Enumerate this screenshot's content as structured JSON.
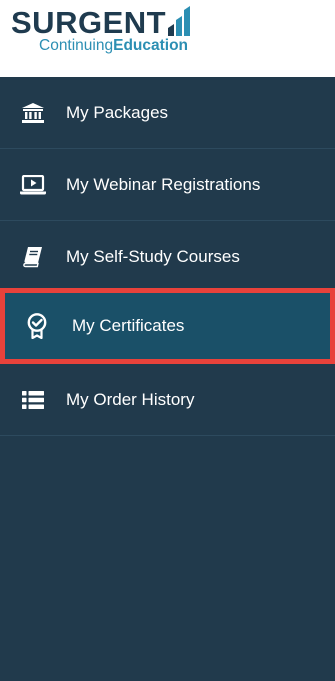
{
  "logo": {
    "word": "SURGENT",
    "sub_regular": "Continuing",
    "sub_bold": "Education"
  },
  "colors": {
    "sidebar_bg": "#213a4c",
    "active_bg": "#1a5068",
    "highlight": "#e8423b",
    "logo_dark": "#1f3b4f",
    "logo_accent": "#2c8fb3"
  },
  "nav": {
    "items": [
      {
        "label": "My Packages",
        "icon": "bank-icon"
      },
      {
        "label": "My Webinar Registrations",
        "icon": "laptop-play-icon"
      },
      {
        "label": "My Self-Study Courses",
        "icon": "book-icon"
      },
      {
        "label": "My Certificates",
        "icon": "award-badge-icon",
        "active": true
      },
      {
        "label": "My Order History",
        "icon": "list-icon"
      }
    ]
  }
}
